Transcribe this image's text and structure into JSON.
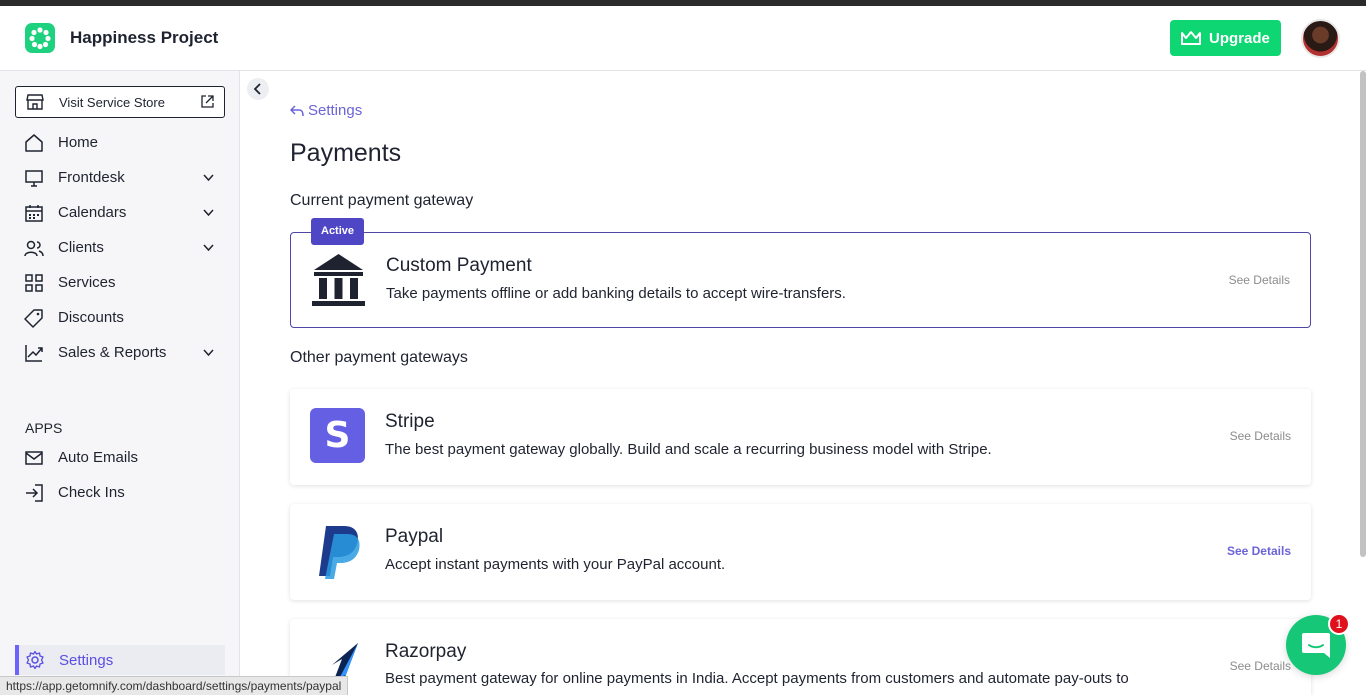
{
  "header": {
    "brand": "Happiness Project",
    "upgrade_label": "Upgrade"
  },
  "sidebar": {
    "store_button": "Visit Service Store",
    "items": [
      {
        "label": "Home"
      },
      {
        "label": "Frontdesk"
      },
      {
        "label": "Calendars"
      },
      {
        "label": "Clients"
      },
      {
        "label": "Services"
      },
      {
        "label": "Discounts"
      },
      {
        "label": "Sales & Reports"
      }
    ],
    "apps_title": "APPS",
    "apps": [
      {
        "label": "Auto Emails"
      },
      {
        "label": "Check Ins"
      }
    ],
    "settings_label": "Settings"
  },
  "main": {
    "back_label": "Settings",
    "title": "Payments",
    "current_section": "Current payment gateway",
    "other_section": "Other payment gateways",
    "active_badge": "Active",
    "gateways": [
      {
        "name": "Custom Payment",
        "desc": "Take payments offline or add banking details to accept wire-transfers.",
        "details": "See Details"
      },
      {
        "name": "Stripe",
        "desc": "The best payment gateway globally. Build and scale a recurring business model with Stripe.",
        "details": "See Details",
        "logo_text": "S"
      },
      {
        "name": "Paypal",
        "desc": "Accept instant payments with your PayPal account.",
        "details": "See Details"
      },
      {
        "name": "Razorpay",
        "desc": "Best payment gateway for online payments in India. Accept payments from customers and automate pay-outs to",
        "details": "See Details"
      }
    ]
  },
  "status_bar": "https://app.getomnify.com/dashboard/settings/payments/paypal",
  "chat": {
    "badge_count": "1"
  },
  "colors": {
    "accent": "#6b63d8",
    "green": "#0ed673",
    "active_border": "#4f46a8"
  }
}
